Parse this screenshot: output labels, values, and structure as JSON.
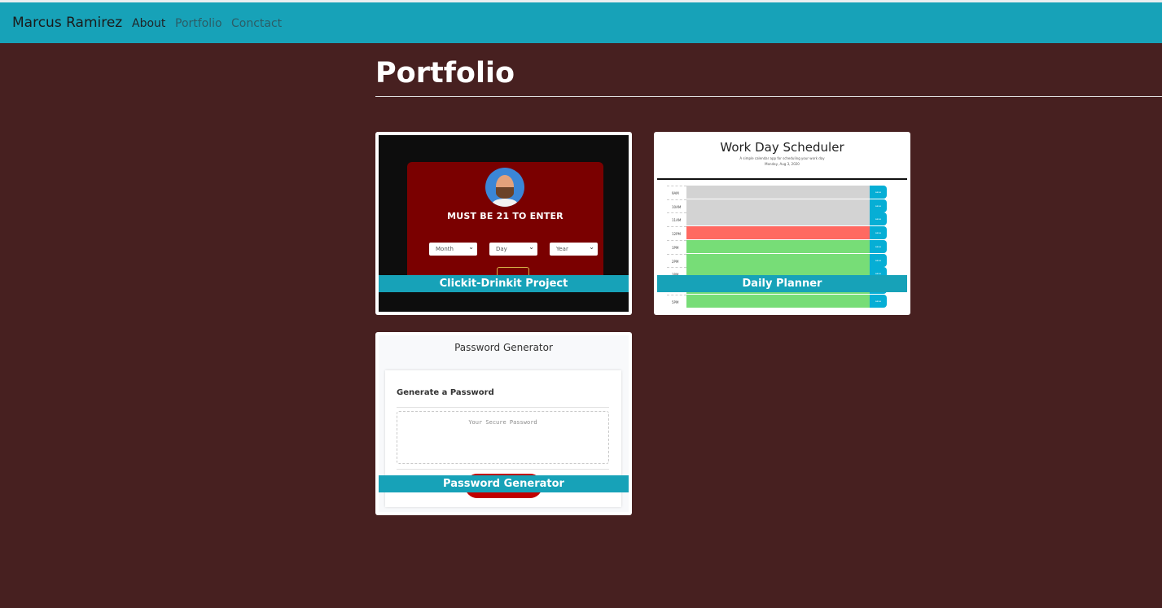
{
  "nav": {
    "brand": "Marcus Ramirez",
    "links": [
      "About",
      "Portfolio",
      "Conctact"
    ]
  },
  "page": {
    "title": "Portfolio"
  },
  "projects": [
    {
      "caption": "Clickit-Drinkit Project",
      "preview": {
        "headline": "MUST BE 21 TO ENTER",
        "selects": [
          "Month",
          "Day",
          "Year"
        ]
      }
    },
    {
      "caption": "Daily Planner",
      "preview": {
        "title": "Work Day Scheduler",
        "subtitle": "A simple calendar app for scheduling your work day",
        "date": "Monday, Aug 3, 2020",
        "hours": [
          "9AM",
          "10AM",
          "11AM",
          "12PM",
          "1PM",
          "2PM",
          "3PM",
          "4PM",
          "5PM"
        ],
        "slot_states": [
          "past",
          "past",
          "past",
          "present",
          "future",
          "future",
          "future",
          "future",
          "future"
        ],
        "save_label": "save"
      }
    },
    {
      "caption": "Password Generator",
      "preview": {
        "header": "Password Generator",
        "card_title": "Generate a Password",
        "placeholder": "Your Secure Password"
      }
    }
  ],
  "colors": {
    "background": "#472020",
    "navbar": "#17a2b8",
    "caption_bar": "#17a2b8",
    "slot_past": "#d3d3d3",
    "slot_present": "#ff6961",
    "slot_future": "#77dd77",
    "save_button": "#06aed5"
  }
}
